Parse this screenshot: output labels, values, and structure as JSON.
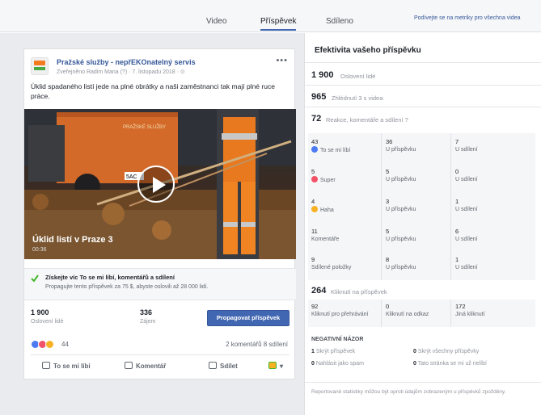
{
  "tabs": [
    "Video",
    "Příspěvek",
    "Sdíleno"
  ],
  "metrics_link": "Podívejte se na metriky pro všechna videa",
  "post": {
    "page_name": "Pražské služby - nepřEKOnatelný servis",
    "meta": "Zveřejněno Radim Mana (?) · 7. listopadu 2018 · ",
    "text": "Úklid spadaného listí jede na plné obrátky a naši zaměstnanci tak mají plné ruce práce.",
    "video_title": "Úklid listí v Praze 3",
    "video_time": "00:36",
    "truck_text": "PRAŽSKÉ SLUŽBY",
    "plate": "5AC",
    "boost_title": "Získejte víc To se mi líbí, komentářů a sdílení",
    "boost_sub": "Propagujte tento příspěvek za 75 $, abyste oslovili až 28 000 lidí.",
    "reach_value": "1 900",
    "reach_label": "Oslovení lidé",
    "engagement_value": "336",
    "engagement_label": "Zájem",
    "promote_label": "Propagovat příspěvek",
    "reaction_count": "44",
    "comments_shares": "2 komentářů  8 sdílení",
    "actions": [
      "To se mi líbí",
      "Komentář",
      "Sdílet"
    ]
  },
  "panel": {
    "title": "Efektivita vašeho příspěvku",
    "reached_value": "1 900",
    "reached_label": "Oslovení lidé",
    "views_value": "965",
    "views_label": "Zhlédnutí 3 s videa",
    "reactions_value": "72",
    "reactions_label": "Reakce, komentáře a sdílení",
    "rows": [
      {
        "v1": "43",
        "l1": "To se mi líbí",
        "v2": "36",
        "l2": "U příspěvku",
        "v3": "7",
        "l3": "U sdílení"
      },
      {
        "v1": "5",
        "l1": "Super",
        "v2": "5",
        "l2": "U příspěvku",
        "v3": "0",
        "l3": "U sdílení"
      },
      {
        "v1": "4",
        "l1": "Haha",
        "v2": "3",
        "l2": "U příspěvku",
        "v3": "1",
        "l3": "U sdílení"
      },
      {
        "v1": "11",
        "l1": "Komentáře",
        "v2": "5",
        "l2": "U příspěvku",
        "v3": "6",
        "l3": "U sdílení"
      },
      {
        "v1": "9",
        "l1": "Sdílené položky",
        "v2": "8",
        "l2": "U příspěvku",
        "v3": "1",
        "l3": "U sdílení"
      }
    ],
    "clicks_value": "264",
    "clicks_label": "Kliknutí na příspěvek",
    "clicks": [
      {
        "v": "92",
        "l": "Kliknutí pro přehrávání"
      },
      {
        "v": "0",
        "l": "Kliknutí na odkaz"
      },
      {
        "v": "172",
        "l": "Jiná kliknutí"
      }
    ],
    "negative_title": "NEGATIVNÍ NÁZOR",
    "negative": [
      {
        "v": "1",
        "l": "Skrýt příspěvek"
      },
      {
        "v": "0",
        "l": "Skrýt všechny příspěvky"
      },
      {
        "v": "0",
        "l": "Nahlásit jako spam"
      },
      {
        "v": "0",
        "l": "Tato stránka se mi už nelíbí"
      }
    ],
    "footnote": "Reportované statistiky můžou být oproti údajům zobrazeným u příspěvků zpožděny."
  },
  "colors": {
    "accent": "#4267b2",
    "link": "#365899",
    "love": "#f25268",
    "haha": "#f7b125",
    "like": "#4c7bf3"
  }
}
